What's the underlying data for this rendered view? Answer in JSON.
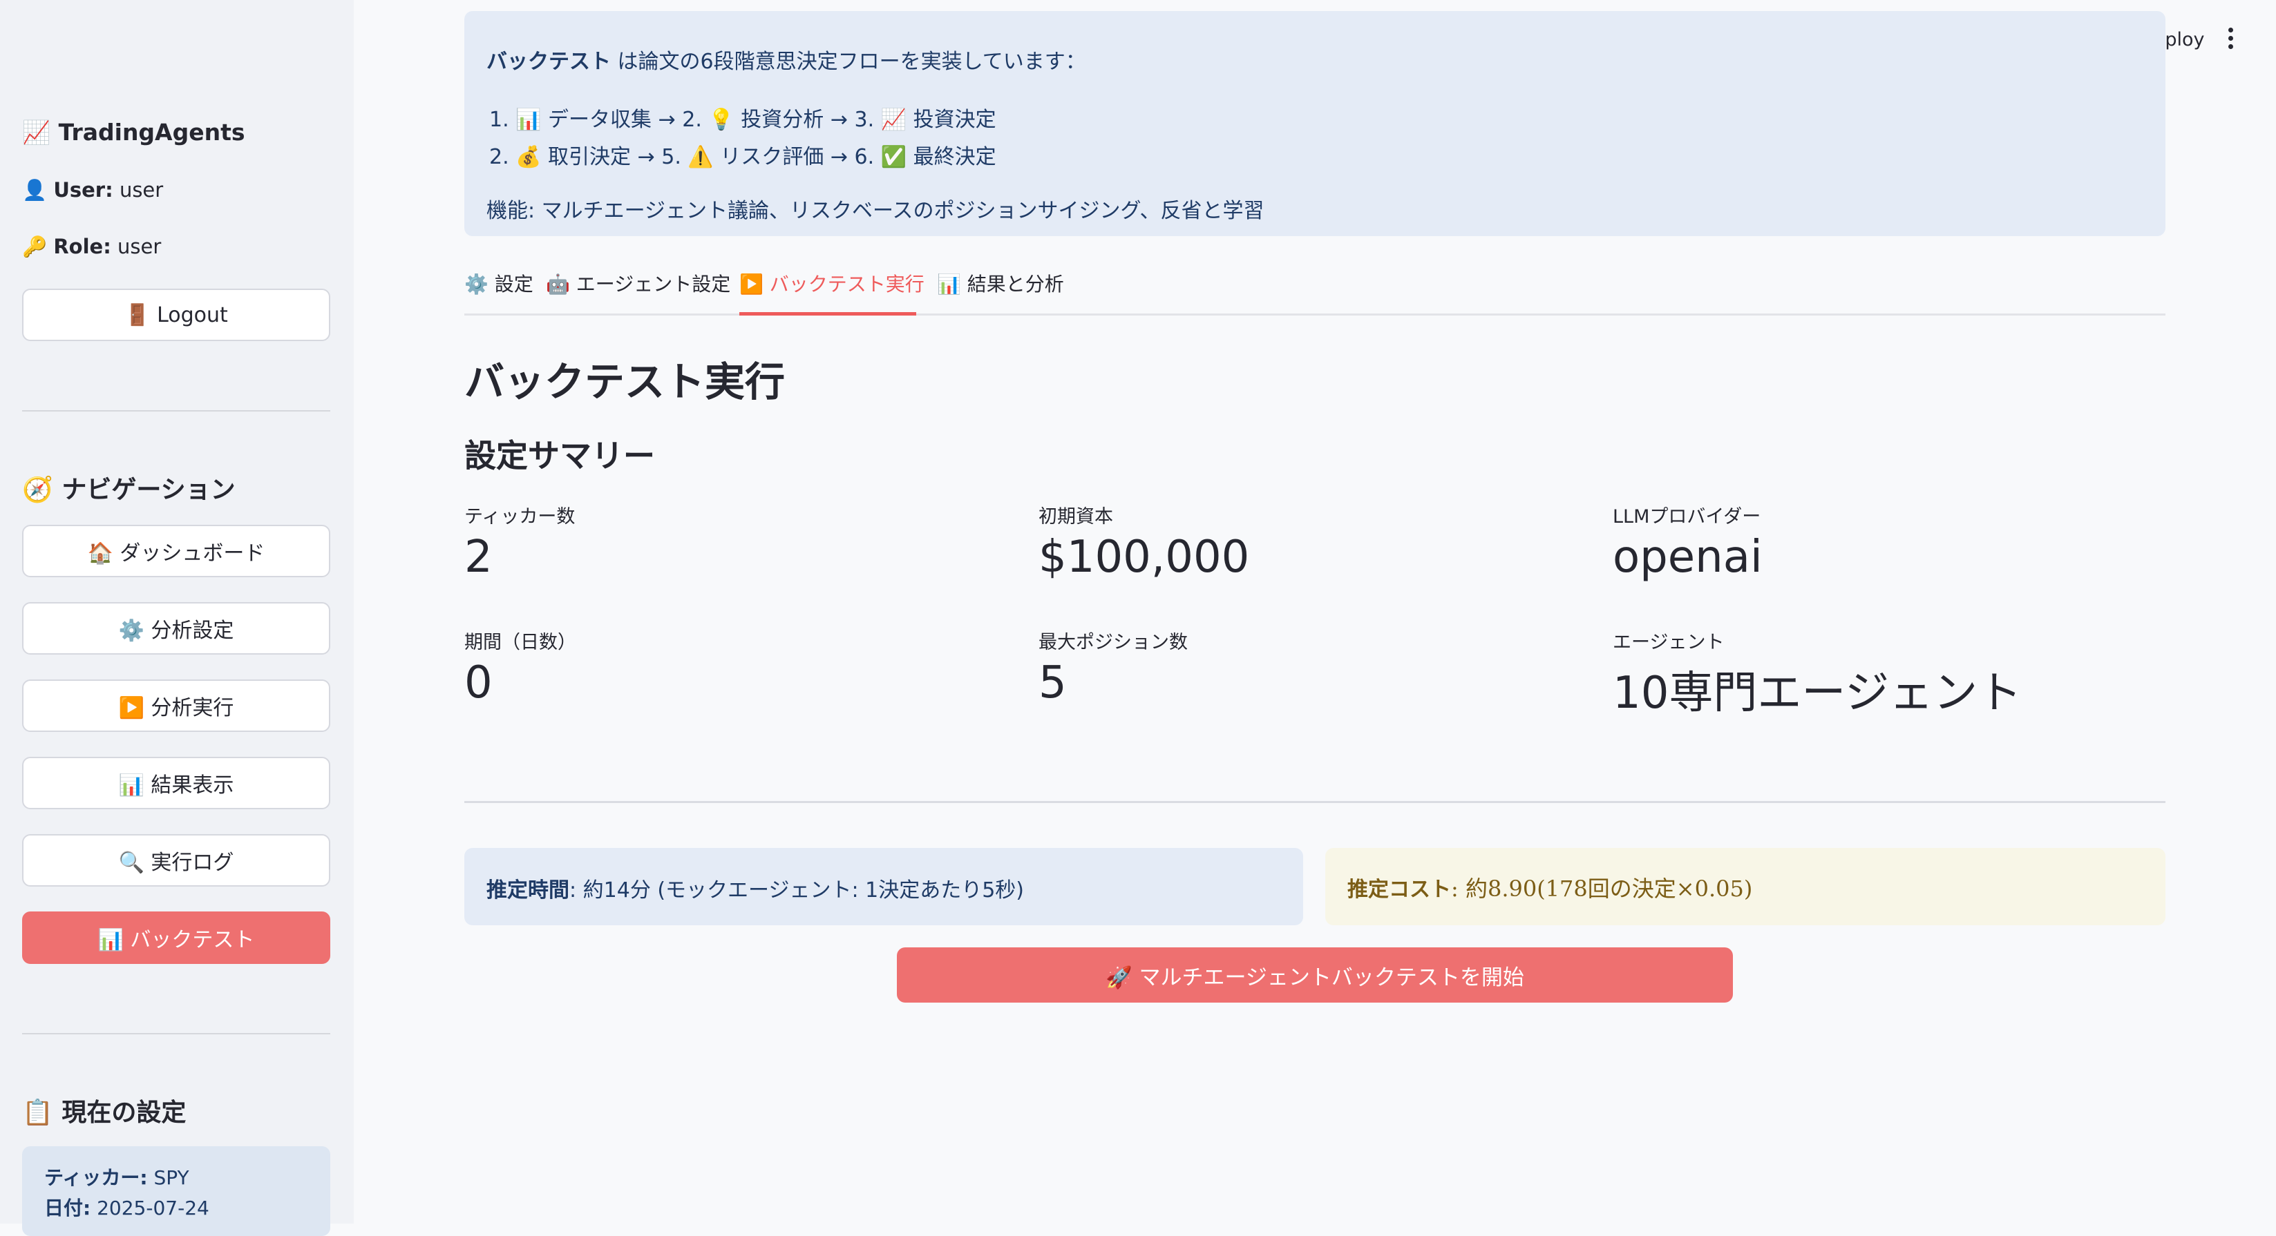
{
  "sidebar": {
    "app_title": "📈 TradingAgents",
    "user_label": "User:",
    "user_value": "user",
    "user_icon": "👤",
    "role_label": "Role:",
    "role_value": "user",
    "role_icon": "🔑",
    "logout_label": "🚪 Logout",
    "nav_heading": "🧭 ナビゲーション",
    "nav_items": [
      {
        "label": "🏠 ダッシュボード",
        "active": false
      },
      {
        "label": "⚙️ 分析設定",
        "active": false
      },
      {
        "label": "▶️ 分析実行",
        "active": false
      },
      {
        "label": "📊 結果表示",
        "active": false
      },
      {
        "label": "🔍 実行ログ",
        "active": false
      },
      {
        "label": "📊 バックテスト",
        "active": true
      }
    ],
    "current_heading": "📋 現在の設定",
    "current": {
      "ticker_label": "ティッカー:",
      "ticker_value": "SPY",
      "date_label": "日付:",
      "date_value": "2025-07-24"
    }
  },
  "header": {
    "deploy_label": "Deploy"
  },
  "info": {
    "intro_bold": "バックテスト",
    "intro_rest": " は論文の6段階意思決定フローを実装しています：",
    "step_line_1": "1.  📊 データ収集 → 2. 💡 投資分析 → 3. 📈 投資決定",
    "step_line_2": "2.  💰 取引決定 → 5. ⚠️ リスク評価 → 6. ✅ 最終決定",
    "features": "機能: マルチエージェント議論、リスクベースのポジションサイジング、反省と学習"
  },
  "tabs": [
    {
      "label": "⚙️ 設定",
      "active": false
    },
    {
      "label": "🤖 エージェント設定",
      "active": false
    },
    {
      "label": "▶️ バックテスト実行",
      "active": true
    },
    {
      "label": "📊 結果と分析",
      "active": false
    }
  ],
  "main": {
    "title": "バックテスト実行",
    "summary_heading": "設定サマリー",
    "metrics": [
      {
        "label": "ティッカー数",
        "value": "2"
      },
      {
        "label": "初期資本",
        "value": "$100,000"
      },
      {
        "label": "LLMプロバイダー",
        "value": "openai"
      },
      {
        "label": "期間（日数）",
        "value": "0"
      },
      {
        "label": "最大ポジション数",
        "value": "5"
      },
      {
        "label": "エージェント",
        "value": "10専門エージェント"
      }
    ],
    "est_time_label": "推定時間",
    "est_time_value": ": 約14分 (モックエージェント: 1決定あたり5秒)",
    "est_cost_label": "推定コスト",
    "est_cost_value": ": 約8.90(178回の決定×0.05)",
    "start_button": "🚀 マルチエージェントバックテストを開始"
  },
  "colors": {
    "accent": "#ee7070",
    "info_bg": "#e4ebf6",
    "warning_bg": "#f8f6e7",
    "sidebar_bg": "#f0f2f6"
  }
}
